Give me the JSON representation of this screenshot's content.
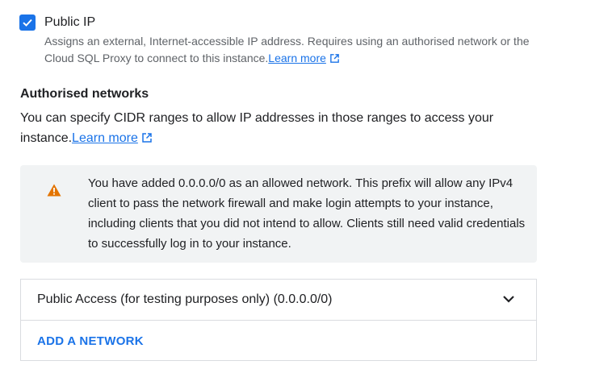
{
  "public_ip": {
    "checkbox_label": "Public IP",
    "checked": true,
    "help_text": "Assigns an external, Internet-accessible IP address. Requires using an authorised network or the Cloud SQL Proxy to connect to this instance.",
    "learn_more": "Learn more",
    "icon": "external-link-icon"
  },
  "authorised_networks": {
    "title": "Authorised networks",
    "description": "You can specify CIDR ranges to allow IP addresses in those ranges to access your instance.",
    "learn_more": "Learn more",
    "icon": "external-link-icon"
  },
  "warning": {
    "icon": "warning-icon",
    "text": "You have added 0.0.0.0/0 as an allowed network. This prefix will allow any IPv4 client to pass the network firewall and make login attempts to your instance, including clients that you did not intend to allow. Clients still need valid credentials to successfully log in to your instance."
  },
  "networks": {
    "items": [
      {
        "label": "Public Access (for testing purposes only) (0.0.0.0/0)",
        "icon": "chevron-down-icon"
      }
    ],
    "add_button": "ADD A NETWORK"
  },
  "colors": {
    "accent": "#1a73e8",
    "warning": "#e37400",
    "warning_bg": "#f1f3f4",
    "border": "#dadce0"
  }
}
